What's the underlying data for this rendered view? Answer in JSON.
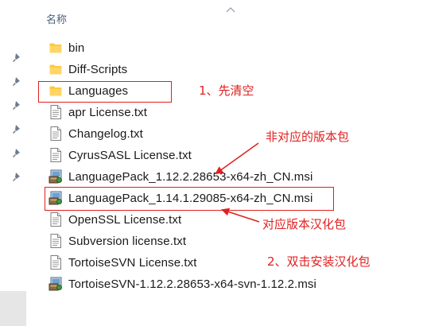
{
  "header": {
    "name_column": "名称"
  },
  "quick_access_pins": [
    {
      "icon": "pin-icon"
    },
    {
      "icon": "pin-icon"
    },
    {
      "icon": "pin-icon"
    },
    {
      "icon": "pin-icon"
    },
    {
      "icon": "pin-icon"
    },
    {
      "icon": "pin-icon"
    }
  ],
  "files": [
    {
      "name": "bin",
      "type": "folder"
    },
    {
      "name": "Diff-Scripts",
      "type": "folder"
    },
    {
      "name": "Languages",
      "type": "folder"
    },
    {
      "name": "apr License.txt",
      "type": "text"
    },
    {
      "name": "Changelog.txt",
      "type": "text"
    },
    {
      "name": "CyrusSASL License.txt",
      "type": "text"
    },
    {
      "name": "LanguagePack_1.12.2.28653-x64-zh_CN.msi",
      "type": "msi"
    },
    {
      "name": "LanguagePack_1.14.1.29085-x64-zh_CN.msi",
      "type": "msi"
    },
    {
      "name": "OpenSSL License.txt",
      "type": "text"
    },
    {
      "name": "Subversion license.txt",
      "type": "text"
    },
    {
      "name": "TortoiseSVN License.txt",
      "type": "text"
    },
    {
      "name": "TortoiseSVN-1.12.2.28653-x64-svn-1.12.2.msi",
      "type": "msi"
    }
  ],
  "annotations": {
    "clear_first": "1、先清空",
    "not_matching": "非对应的版本包",
    "matching": "对应版本汉化包",
    "double_click": "2、双击安装汉化包"
  },
  "colors": {
    "annotation_red": "#e02020",
    "folder_yellow": "#ffc83d",
    "header_text": "#4c607a"
  }
}
